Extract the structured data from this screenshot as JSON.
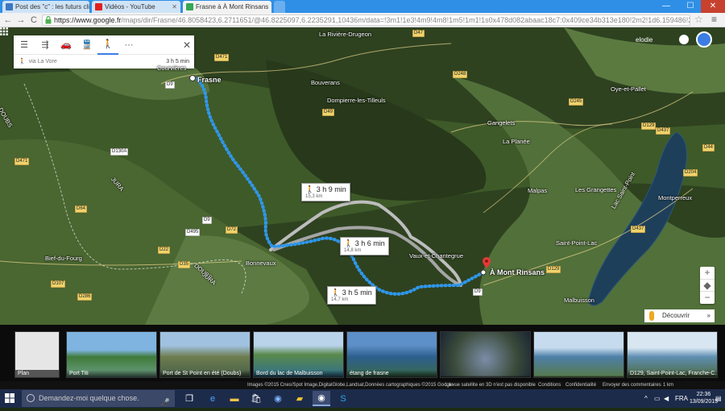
{
  "browser": {
    "tabs": [
      {
        "label": "Post des \"c\" : les futurs cli",
        "color": "#3b78c2"
      },
      {
        "label": "Vidéos - YouTube",
        "color": "#e02020"
      },
      {
        "label": "Frasne à À Mont Rinsans",
        "color": "#34a853"
      }
    ],
    "window": {
      "minimize": "—",
      "maximize": "☐",
      "close": "✕"
    },
    "url_host": "https://www.google.fr",
    "url_path": "/maps/dir/Frasne/46.8058423,6.2711651/@46.8225097,6.2235291,10436m/data=!3m1!1e3!4m9!4m8!1m5!1m1!1s0x478d082abaac18c7:0x409ce34b313e180!2m2!1d6.159486!2d46.",
    "nav": {
      "back": "←",
      "forward": "→",
      "reload": "C",
      "star": "☆",
      "menu": "≡"
    }
  },
  "directions": {
    "menu_icon": "hamburger-icon",
    "modes": [
      "best-route-icon",
      "car-icon",
      "transit-icon",
      "walk-icon",
      "more-icon"
    ],
    "more_label": "···",
    "close_label": "✕",
    "route_via": "via La Vore",
    "route_time": "3 h 5 min"
  },
  "account": {
    "name": "elodie"
  },
  "places": [
    {
      "label": "Frasne",
      "major": true
    },
    {
      "label": "Courvières",
      "major": false
    },
    {
      "label": "La Rivière-Drugeon",
      "major": false
    },
    {
      "label": "Bouverans",
      "major": false
    },
    {
      "label": "Dompierre-les-Tilleuls",
      "major": false
    },
    {
      "label": "Oye-et-Pallet",
      "major": false
    },
    {
      "label": "Gangelets",
      "major": false
    },
    {
      "label": "La Planée",
      "major": false
    },
    {
      "label": "Malpas",
      "major": false
    },
    {
      "label": "Les Grangettes",
      "major": false
    },
    {
      "label": "Montperreux",
      "major": false
    },
    {
      "label": "Saint-Point-Lac",
      "major": false
    },
    {
      "label": "Malbuisson",
      "major": false
    },
    {
      "label": "Vaux-et-Chantegrue",
      "major": false
    },
    {
      "label": "Bonnevaux",
      "major": false
    },
    {
      "label": "Bief-du-Fourg",
      "major": false
    },
    {
      "label": "Lac Saint-Point",
      "major": false
    }
  ],
  "roads": [
    "D9",
    "D471",
    "D47",
    "D49",
    "D248",
    "D245",
    "D437",
    "D129",
    "D44",
    "D204",
    "D471",
    "D130A",
    "D64",
    "D9",
    "D72",
    "D22",
    "D495",
    "D35",
    "D107",
    "D286",
    "D437",
    "D129",
    "D9"
  ],
  "side_labels": [
    "DOUBS",
    "JURA",
    "DOUBS",
    "JURA"
  ],
  "routes": [
    {
      "time": "3 h 9 min",
      "distance": "15,3 km"
    },
    {
      "time": "3 h 6 min",
      "distance": "14,8 km"
    },
    {
      "time": "3 h 5 min",
      "distance": "14,7 km"
    }
  ],
  "destination": {
    "label": "À Mont Rinsans"
  },
  "controls": {
    "discover": "Découvrir",
    "zoom_in": "+",
    "zoom_out": "−",
    "expand": "»"
  },
  "photos": [
    {
      "label": "Plan"
    },
    {
      "label": "Port Titi"
    },
    {
      "label": "Port de St Point en été (Doubs)"
    },
    {
      "label": "Bord du lac de Malbuisson"
    },
    {
      "label": "étang de frasne"
    },
    {
      "label": ""
    },
    {
      "label": ""
    },
    {
      "label": "D129, Saint-Point-Lac, Franche-C..."
    }
  ],
  "attribution": {
    "images": "Images ©2015 Cnes/Spot Image,DigitalGlobe,Landsat,Données cartographiques ©2015 Google",
    "satellite": "La vue satellite en 3D n'est pas disponible",
    "terms": "Conditions",
    "privacy": "Confidentialité",
    "feedback": "Envoyer des commentaires",
    "scale": "1 km"
  },
  "taskbar": {
    "search_placeholder": "Demandez-moi quelque chose.",
    "lang": "FRA",
    "time": "22:36",
    "date": "13/09/2015"
  }
}
